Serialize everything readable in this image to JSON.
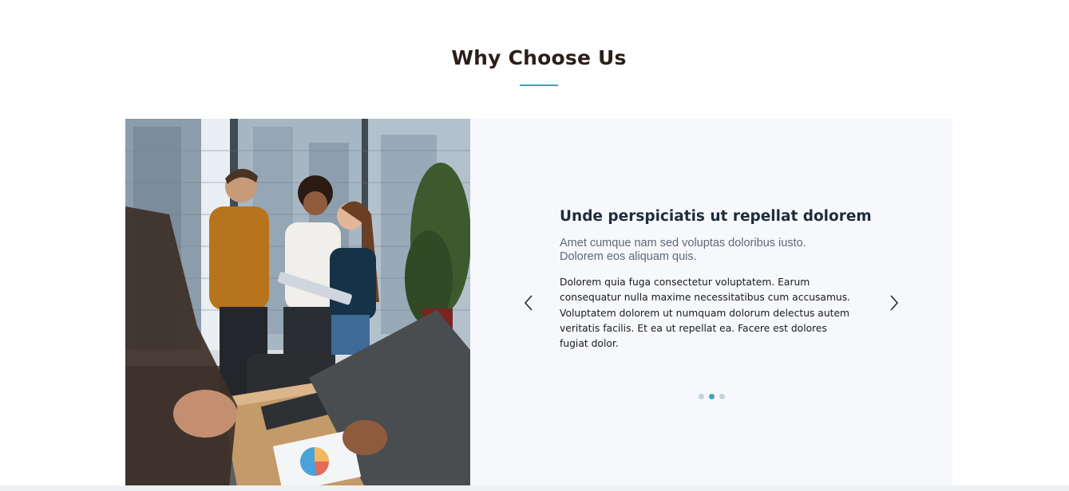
{
  "section": {
    "title": "Why Choose Us",
    "accent_color": "#3aa6bd"
  },
  "image": {
    "description_icon": "office-team-photo"
  },
  "slide": {
    "heading": "Unde perspiciatis ut repellat dolorem",
    "subtitle": "Amet cumque nam sed voluptas doloribus iusto. Dolorem eos aliquam quis.",
    "body": "Dolorem quia fuga consectetur voluptatem. Earum consequatur nulla maxime necessitatibus cum accusamus. Voluptatem dolorem ut numquam dolorum delectus autem veritatis facilis. Et ea ut repellat ea. Facere est dolores fugiat dolor."
  },
  "carousel": {
    "prev_icon": "chevron-left-icon",
    "next_icon": "chevron-right-icon",
    "total_slides": 3,
    "active_index": 1
  }
}
